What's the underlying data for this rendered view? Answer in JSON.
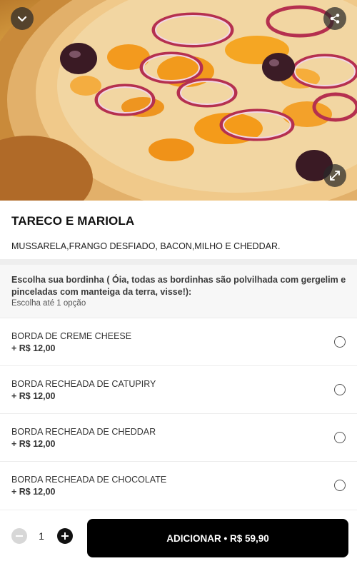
{
  "product": {
    "name": "TARECO E MARIOLA",
    "description": "MUSSARELA,FRANGO DESFIADO, BACON,MILHO E CHEDDAR."
  },
  "hero_buttons": {
    "back_icon": "chevron-down-icon",
    "share_icon": "share-icon",
    "expand_icon": "expand-icon"
  },
  "option_group": {
    "title": "Escolha sua bordinha ( Óia, todas as bordinhas são polvilhada com gergelim e pinceladas com manteiga da terra, visse!):",
    "subtitle": "Escolha até 1 opção",
    "options": [
      {
        "name": "BORDA DE CREME CHEESE",
        "price": "+ R$ 12,00"
      },
      {
        "name": "BORDA RECHEADA DE CATUPIRY",
        "price": "+ R$ 12,00"
      },
      {
        "name": "BORDA RECHEADA DE CHEDDAR",
        "price": "+ R$ 12,00"
      },
      {
        "name": "BORDA RECHEADA DE CHOCOLATE",
        "price": "+ R$ 12,00"
      }
    ]
  },
  "footer": {
    "quantity": "1",
    "add_label": "ADICIONAR • R$ 59,90"
  },
  "colors": {
    "primary_button": "#000000",
    "divider": "#eeeeee",
    "qty_minus_disabled": "#d7d7d7"
  }
}
